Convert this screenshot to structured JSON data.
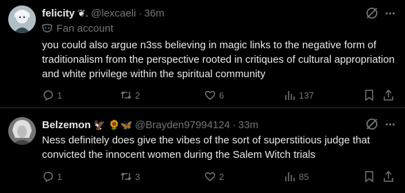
{
  "colors": {
    "background": "#000000",
    "text": "#e7e9ea",
    "secondary": "#71767b",
    "divider": "#2f3336"
  },
  "tweets": [
    {
      "author": {
        "display_name": "felicity",
        "badge_emoji": "❦.",
        "handle": "@lexcaeli",
        "time": "36m"
      },
      "context_label": "Fan account",
      "text": "you could also argue n3ss believing in magic links to the negative form of traditionalism from the perspective rooted in critiques of cultural appropriation and white privilege within the spiritual community",
      "stats": {
        "replies": "1",
        "reposts": "2",
        "likes": "6",
        "views": "137"
      }
    },
    {
      "author": {
        "display_name": "Belzemon",
        "badge_emoji": "🦅 🌻🦋",
        "handle": "@Brayden97994124",
        "time": "33m"
      },
      "text": "Ness definitely does give the vibes of the sort of superstitious judge that convicted the innocent women during the Salem Witch trials",
      "stats": {
        "replies": "1",
        "reposts": "3",
        "likes": "2",
        "views": "85"
      }
    }
  ],
  "icons": {
    "grok": "grok-icon",
    "more": "more-icon",
    "reply": "reply-icon",
    "repost": "repost-icon",
    "like": "like-icon",
    "views": "views-icon",
    "bookmark": "bookmark-icon",
    "share": "share-icon",
    "context": "mask-icon"
  }
}
